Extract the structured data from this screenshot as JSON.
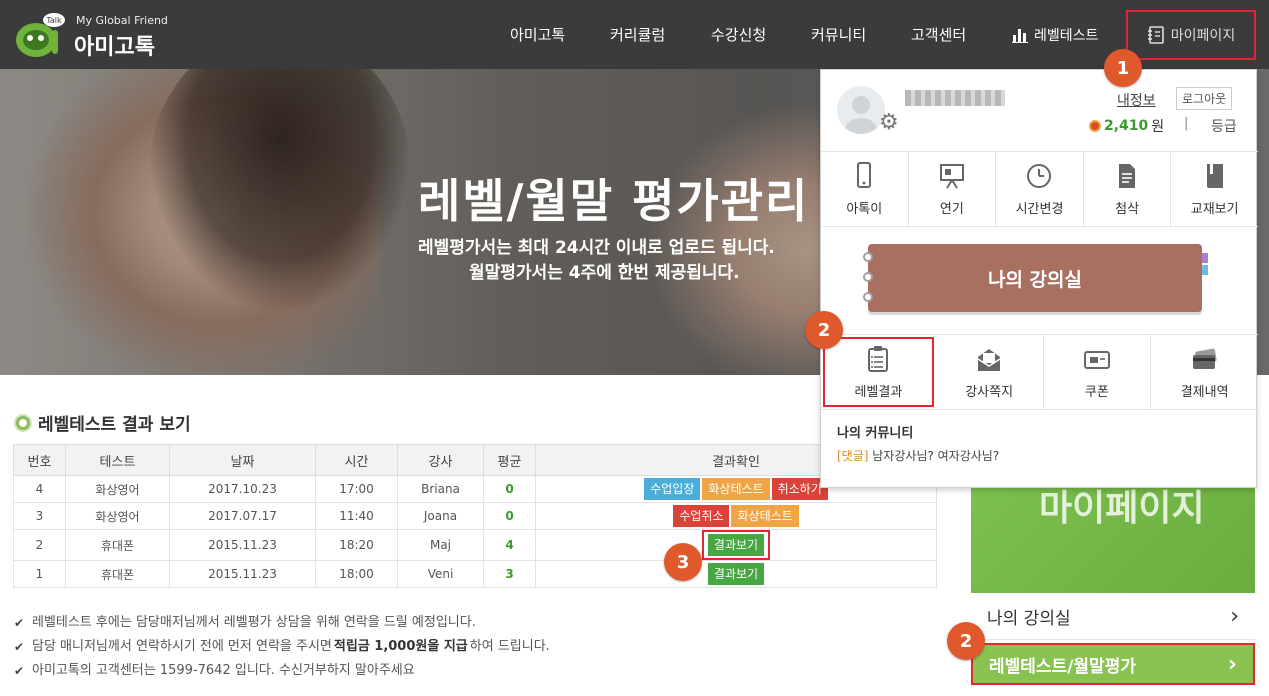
{
  "header": {
    "logo_tagline": "My Global Friend",
    "logo_name": "아미고톡",
    "logo_badge": "Talk",
    "nav": [
      "아미고톡",
      "커리큘럼",
      "수강신청",
      "커뮤니티",
      "고객센터"
    ],
    "level_test": "레벨테스트",
    "mypage": "마이페이지"
  },
  "hero": {
    "title": "레벨/월말 평가관리",
    "sub1": "레벨평가서는 최대 24시간 이내로 업로드 됩니다.",
    "sub2": "월말평가서는 4주에 한번 제공됩니다."
  },
  "section_title": "레벨테스트 결과 보기",
  "table": {
    "headers": [
      "번호",
      "테스트",
      "날짜",
      "시간",
      "강사",
      "평균",
      "결과확인"
    ],
    "rows": [
      {
        "no": "4",
        "test": "화상영어",
        "date": "2017.10.23",
        "time": "17:00",
        "teacher": "Briana",
        "avg": "0",
        "actions": [
          "수업입장",
          "화상테스트",
          "취소하기"
        ]
      },
      {
        "no": "3",
        "test": "화상영어",
        "date": "2017.07.17",
        "time": "11:40",
        "teacher": "Joana",
        "avg": "0",
        "actions": [
          "수업취소",
          "화상테스트"
        ]
      },
      {
        "no": "2",
        "test": "휴대폰",
        "date": "2015.11.23",
        "time": "18:20",
        "teacher": "Maj",
        "avg": "4",
        "actions": [
          "결과보기"
        ]
      },
      {
        "no": "1",
        "test": "휴대폰",
        "date": "2015.11.23",
        "time": "18:00",
        "teacher": "Veni",
        "avg": "3",
        "actions": [
          "결과보기"
        ]
      }
    ]
  },
  "notes": {
    "n1": "레벨테스트 후에는 담당매저님께서 레벨평가 상담을 위해 연락을 드릴 예정입니다.",
    "n2_pre": "담당 매니저님께서 연락하시기 전에 먼저 연락을 주시면 ",
    "n2_bold": "적립금 1,000원을 지급",
    "n2_post": "하여 드립니다.",
    "n3": "아미고톡의 고객센터는 1599-7642 입니다. 수신거부하지 말아주세요"
  },
  "side": {
    "banner": "마이페이지",
    "item1": "나의 강의실",
    "item2": "레벨테스트/월말평가",
    "chevron": "›"
  },
  "dropdown": {
    "my_info": "내정보",
    "logout": "로그아웃",
    "points": "2,410",
    "points_unit": "원",
    "separator": "|",
    "grade": "등급",
    "row1": [
      "아톡이",
      "연기",
      "시간변경",
      "첨삭",
      "교재보기"
    ],
    "classroom": "나의 강의실",
    "row2": [
      "레벨결과",
      "강사쪽지",
      "쿠폰",
      "결제내역"
    ],
    "community_title": "나의 커뮤니티",
    "community_tag": "[댓글]",
    "community_post": " 남자강사님? 여자강사님?"
  },
  "steps": [
    "1",
    "2",
    "3",
    "2"
  ],
  "colors": {
    "header_bg": "#3b3b3b",
    "highlight": "#e0262e",
    "step_marker": "#e0592d",
    "green": "#8ac24f",
    "classroom": "#a87061"
  }
}
